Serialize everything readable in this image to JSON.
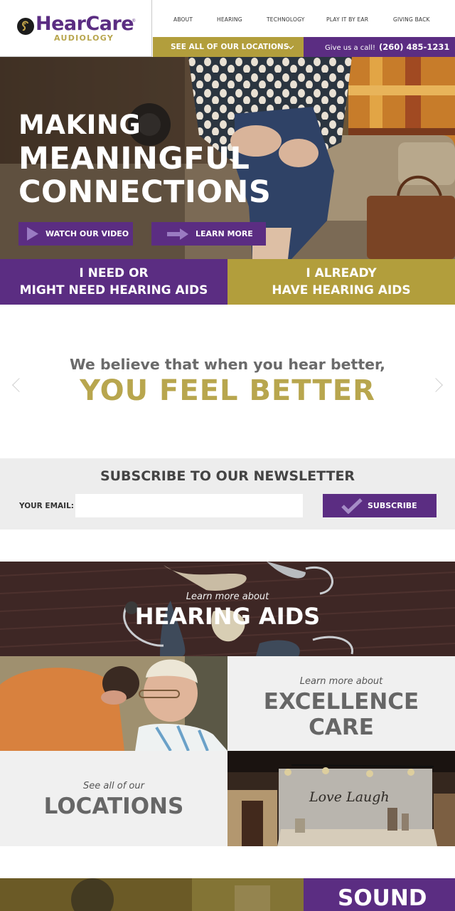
{
  "brand": {
    "name": "HearCare",
    "sub": "AUDIOLOGY",
    "reg": "®",
    "purple": "#5b2d82",
    "gold": "#b29e3c"
  },
  "nav": {
    "items": [
      "ABOUT",
      "HEARING",
      "TECHNOLOGY",
      "PLAY IT BY EAR",
      "GIVING BACK"
    ]
  },
  "locations_bar": {
    "label": "SEE ALL OF OUR LOCATIONS"
  },
  "call_bar": {
    "label": "Give us a call!",
    "phone": "(260) 485-1231"
  },
  "hero": {
    "line1": "MAKING",
    "line2": "MEANINGFUL",
    "line3": "CONNECTIONS",
    "video_button": "WATCH OUR VIDEO",
    "learn_button": "LEARN MORE"
  },
  "cta": {
    "left_line1": "I NEED OR",
    "left_line2": "MIGHT NEED HEARING AIDS",
    "right_line1": "I ALREADY",
    "right_line2": "HAVE HEARING AIDS"
  },
  "quote": {
    "small": "We believe that when you hear better,",
    "big": "YOU FEEL BETTER"
  },
  "newsletter": {
    "title": "SUBSCRIBE TO OUR NEWSLETTER",
    "email_label": "YOUR EMAIL:",
    "email_value": "",
    "button": "SUBSCRIBE"
  },
  "tiles": {
    "hearing_small": "Learn more about",
    "hearing_big": "HEARING AIDS",
    "excellence_small": "Learn more about",
    "excellence_big1": "EXCELLENCE",
    "excellence_big2": "CARE",
    "locations_small": "See all of our",
    "locations_big": "LOCATIONS",
    "sign_text": "Love Laugh",
    "bottom_big": "SOUND"
  }
}
